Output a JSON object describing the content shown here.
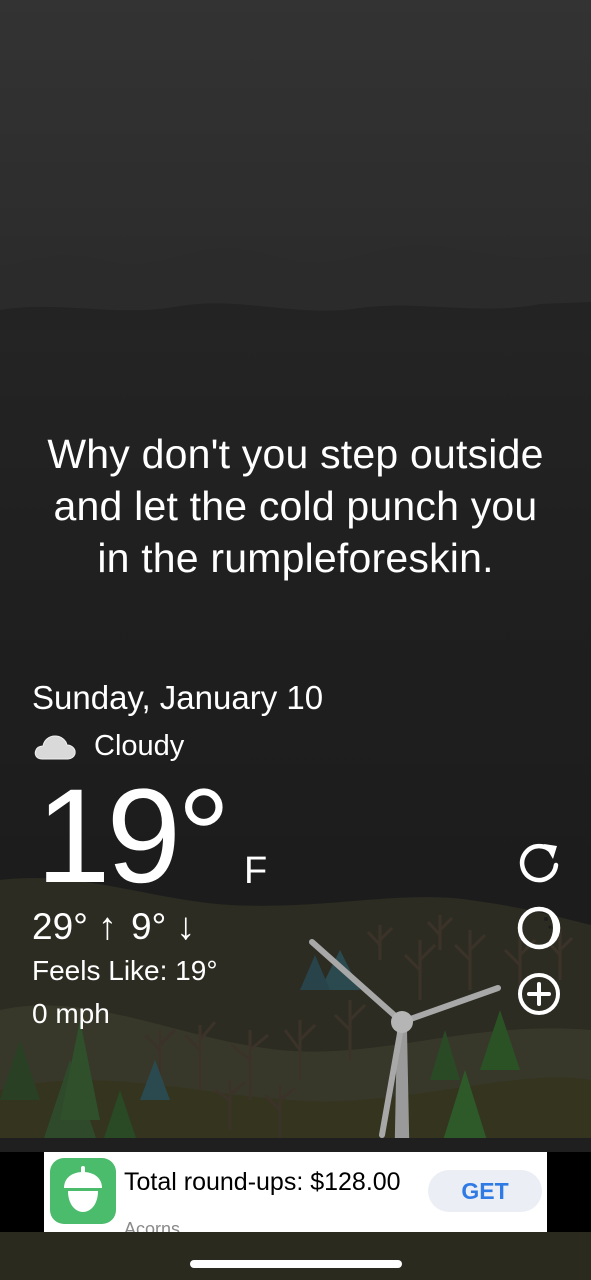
{
  "quote": {
    "line1": "Why don't you step outside",
    "line2": "and let the cold punch you",
    "line3": "in the rumpleforeskin."
  },
  "weather": {
    "date": "Sunday, January 10",
    "condition": "Cloudy",
    "condition_icon": "cloud-icon",
    "temperature": "19°",
    "unit": "F",
    "high": "29°",
    "high_arrow": "↑",
    "low": "9°",
    "low_arrow": "↓",
    "feels_like": "Feels Like: 19°",
    "wind": "0 mph"
  },
  "side_buttons": [
    {
      "icon": "refresh-icon"
    },
    {
      "icon": "moon-phase-icon"
    },
    {
      "icon": "add-circle-icon"
    }
  ],
  "ad": {
    "title": "Total round-ups: $128.00",
    "subtitle": "Acorns",
    "cta": "GET",
    "icon": "acorn-icon",
    "brand_color": "#4bbb6c",
    "cta_color": "#2f7ae5"
  }
}
